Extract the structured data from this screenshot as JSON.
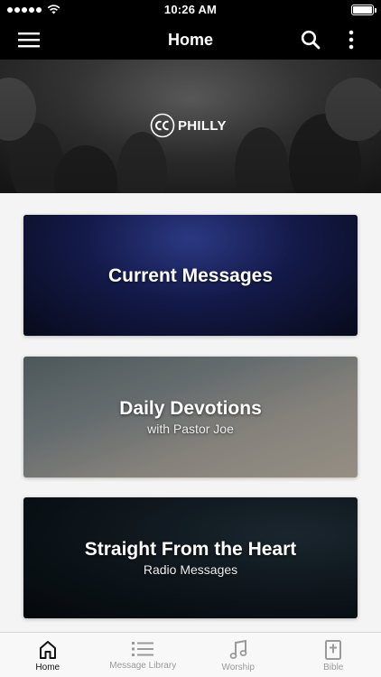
{
  "status_bar": {
    "time": "10:26 AM"
  },
  "nav": {
    "title": "Home"
  },
  "hero": {
    "logo_text": "PHILLY"
  },
  "cards": [
    {
      "title": "Current Messages",
      "subtitle": ""
    },
    {
      "title": "Daily Devotions",
      "subtitle": "with Pastor Joe"
    },
    {
      "title": "Straight From the Heart",
      "subtitle": "Radio Messages"
    }
  ],
  "tabs": [
    {
      "label": "Home",
      "icon": "home-icon",
      "active": true
    },
    {
      "label": "Message Library",
      "icon": "list-icon",
      "active": false
    },
    {
      "label": "Worship",
      "icon": "music-note-icon",
      "active": false
    },
    {
      "label": "Bible",
      "icon": "bible-icon",
      "active": false
    }
  ],
  "colors": {
    "nav_bg": "#000000",
    "tab_active": "#111111",
    "tab_inactive": "#9a9a9a",
    "content_bg": "#f4f4f4"
  }
}
